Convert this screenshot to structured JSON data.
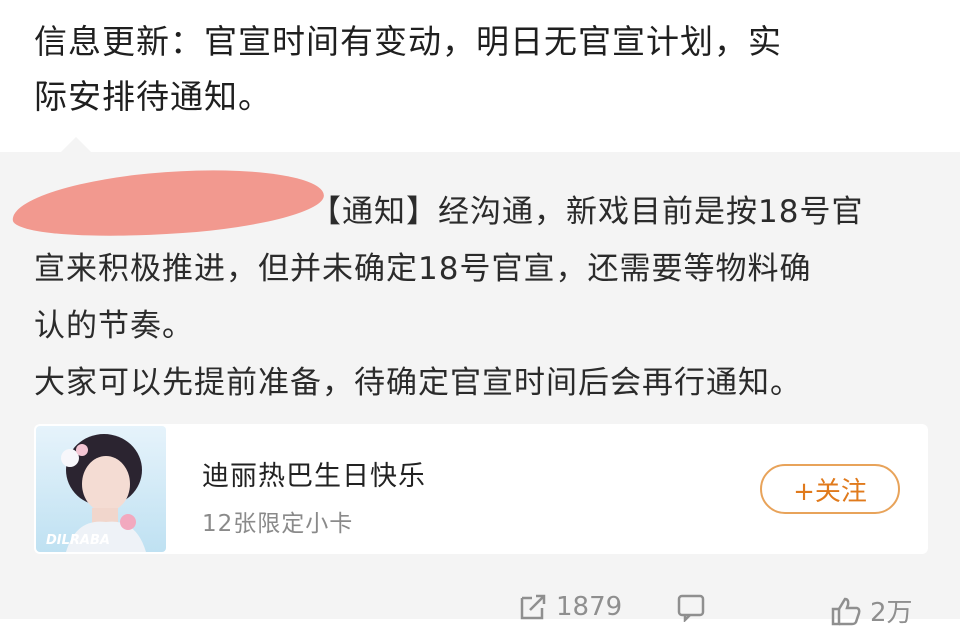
{
  "post": {
    "line1": "信息更新：官宣时间有变动，明日无官宣计划，实",
    "line2": "际安排待通知。"
  },
  "retweet": {
    "line1": "【通知】经沟通，新戏目前是按18号官",
    "line2": "宣来积极推进，但并未确定18号官宣，还需要等物料确",
    "line3": "认的节奏。",
    "line4": "大家可以先提前准备，待确定官宣时间后会再行通知。"
  },
  "card": {
    "title": "迪丽热巴生日快乐",
    "subtitle": "12张限定小卡",
    "follow_label": "+关注",
    "thumb_caption": "DILRABA"
  },
  "actions": {
    "share_count": "1879",
    "comment_count": "",
    "like_count": "2万"
  },
  "colors": {
    "accent": "#e07a1c",
    "redaction": "#f2998f",
    "retweet_bg": "#f4f4f4"
  }
}
